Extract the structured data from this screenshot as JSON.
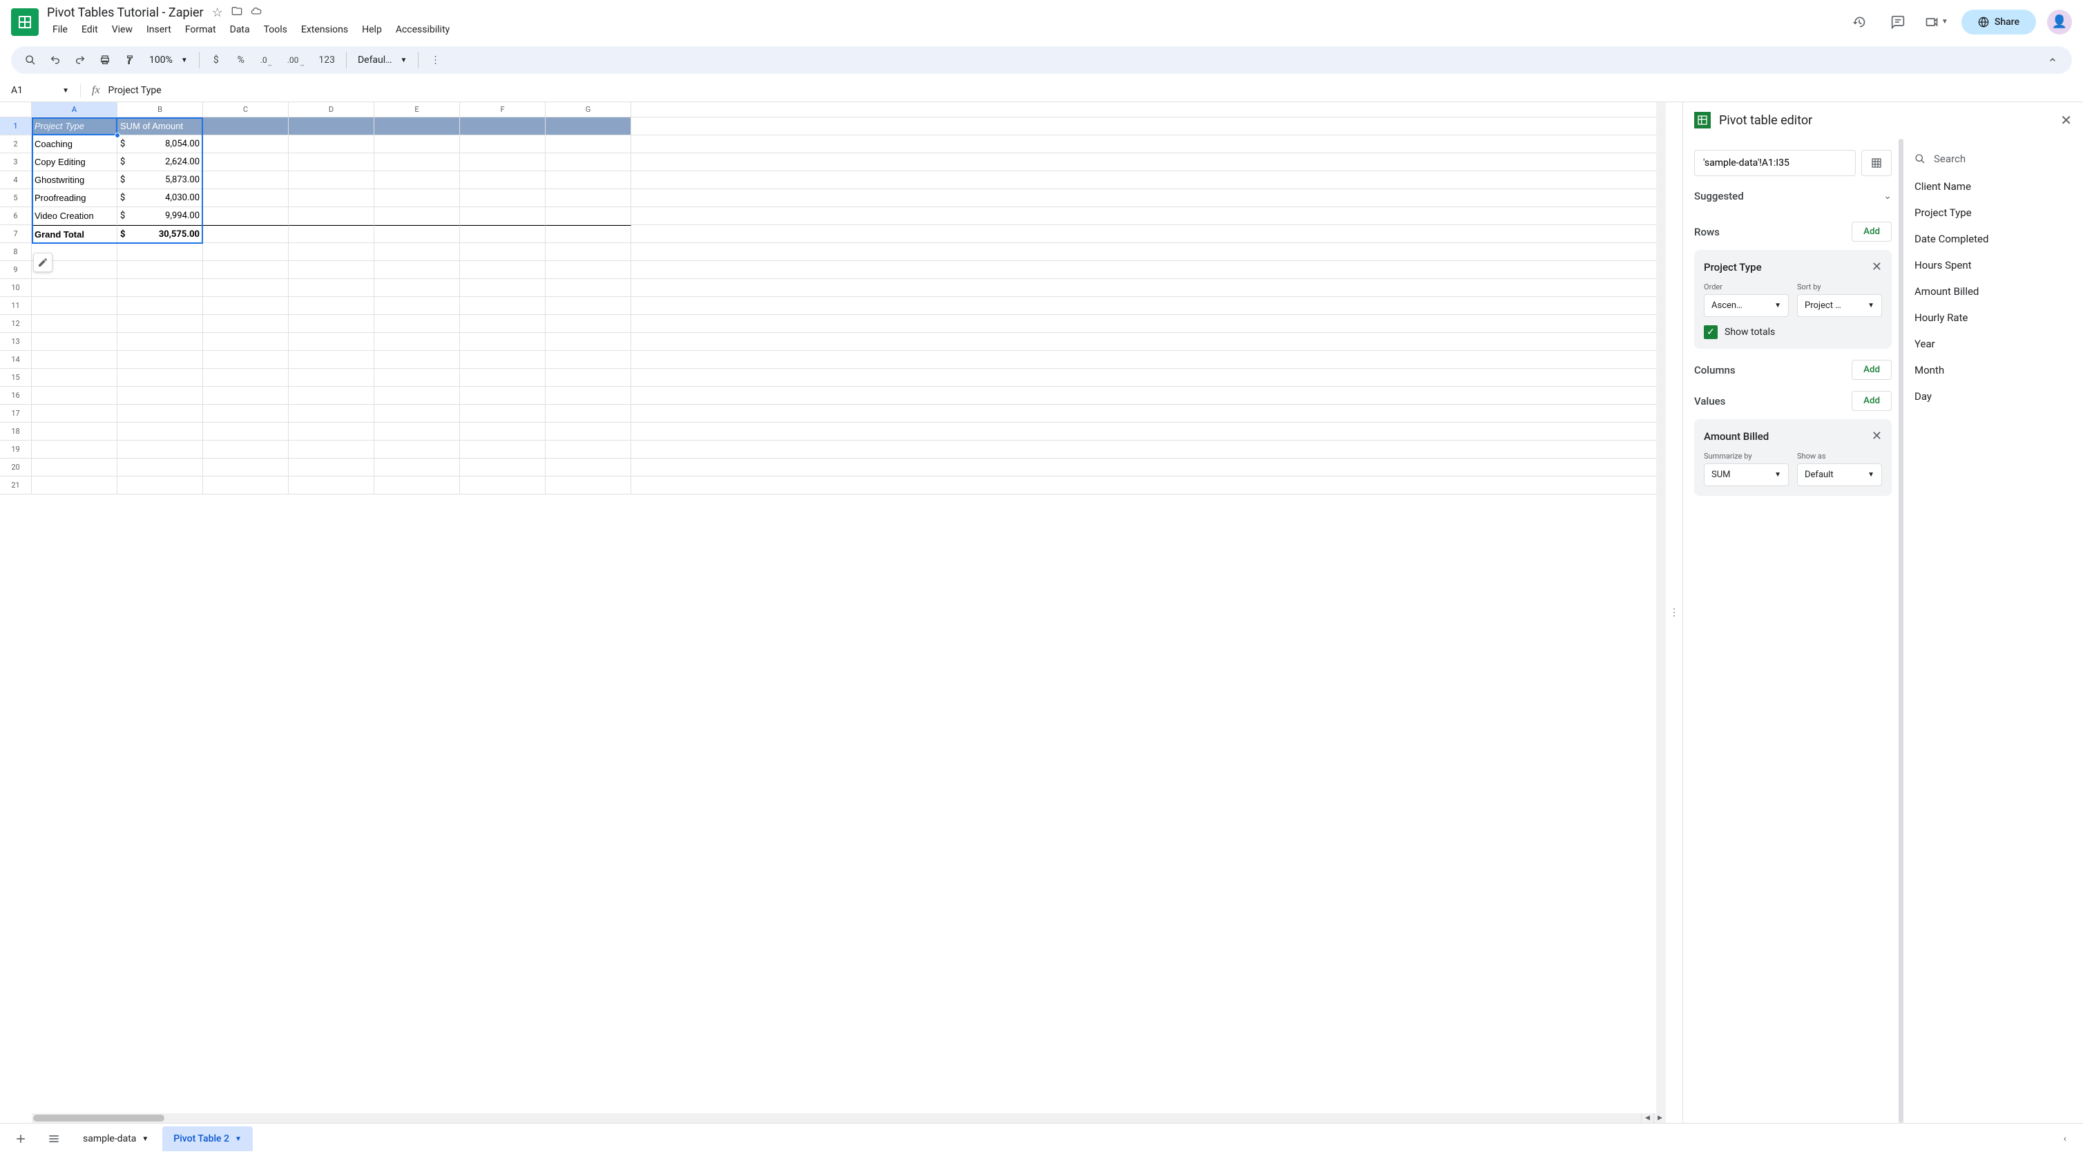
{
  "doc_title": "Pivot Tables Tutorial - Zapier",
  "menu": [
    "File",
    "Edit",
    "View",
    "Insert",
    "Format",
    "Data",
    "Tools",
    "Extensions",
    "Help",
    "Accessibility"
  ],
  "share_label": "Share",
  "toolbar": {
    "zoom": "100%",
    "currency": "$",
    "percent": "%",
    "dec_dec": ".0",
    "inc_dec": ".00",
    "num_format": "123",
    "font": "Defaul…"
  },
  "name_box": "A1",
  "formula_bar": "Project Type",
  "columns": [
    "A",
    "B",
    "C",
    "D",
    "E",
    "F",
    "G"
  ],
  "pivot_table": {
    "header": [
      "Project Type",
      "SUM of  Amount"
    ],
    "rows": [
      {
        "label": "Coaching",
        "sym": "$",
        "val": "8,054.00"
      },
      {
        "label": "Copy Editing",
        "sym": "$",
        "val": "2,624.00"
      },
      {
        "label": "Ghostwriting",
        "sym": "$",
        "val": "5,873.00"
      },
      {
        "label": "Proofreading",
        "sym": "$",
        "val": "4,030.00"
      },
      {
        "label": "Video Creation",
        "sym": "$",
        "val": "9,994.00"
      }
    ],
    "total": {
      "label": "Grand Total",
      "sym": "$",
      "val": "30,575.00"
    }
  },
  "editor": {
    "title": "Pivot table editor",
    "range": "'sample-data'!A1:I35",
    "suggested_label": "Suggested",
    "rows_label": "Rows",
    "columns_label": "Columns",
    "values_label": "Values",
    "add_label": "Add",
    "row_config": {
      "title": "Project Type",
      "order_label": "Order",
      "order_value": "Ascen…",
      "sortby_label": "Sort by",
      "sortby_value": "Project …",
      "show_totals": "Show totals"
    },
    "values_config": {
      "title": "Amount Billed",
      "summarize_label": "Summarize by",
      "summarize_value": "SUM",
      "showas_label": "Show as",
      "showas_value": "Default"
    },
    "search_placeholder": "Search",
    "fields": [
      "Client Name",
      "Project Type",
      "Date Completed",
      "Hours Spent",
      "Amount Billed",
      "Hourly Rate",
      "Year",
      "Month",
      "Day"
    ]
  },
  "tabs": {
    "sheet1": "sample-data",
    "sheet2": "Pivot Table 2"
  }
}
